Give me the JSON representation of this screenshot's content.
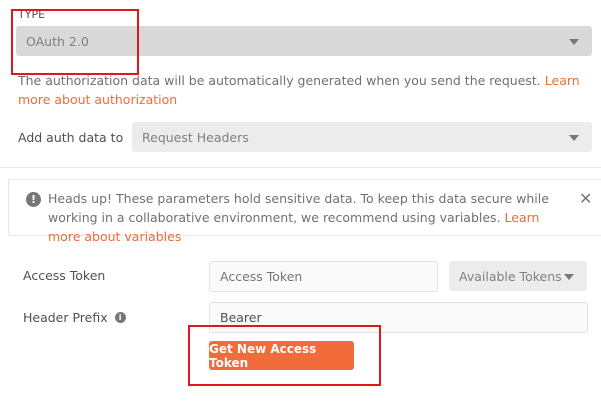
{
  "type": {
    "label": "TYPE",
    "value": "OAuth 2.0"
  },
  "description": {
    "text": "The authorization data will be automatically generated when you send the request. ",
    "link": "Learn more about authorization"
  },
  "add_auth": {
    "label": "Add auth data to",
    "value": "Request Headers"
  },
  "alert": {
    "text": "Heads up! These parameters hold sensitive data. To keep this data secure while working in a collaborative environment, we recommend using variables. ",
    "link": "Learn more about variables"
  },
  "access_token": {
    "label": "Access Token",
    "placeholder": "Access Token",
    "value": "",
    "tokens_label": "Available Tokens"
  },
  "header_prefix": {
    "label": "Header Prefix",
    "value": "Bearer"
  },
  "get_token_button": "Get New Access Token",
  "colors": {
    "accent": "#f26b3a",
    "highlight": "#e2161f"
  }
}
